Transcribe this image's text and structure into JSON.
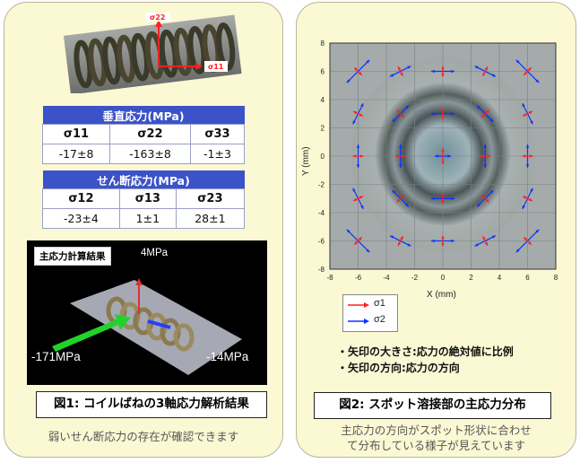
{
  "left": {
    "photo": {
      "s22_label": "σ22",
      "s11_label": "σ11"
    },
    "normal_table": {
      "title": "垂直応力(MPa)",
      "headers": [
        "σ11",
        "σ22",
        "σ33"
      ],
      "values": [
        "-17±8",
        "-163±8",
        "-1±3"
      ]
    },
    "shear_table": {
      "title": "せん断応力(MPa)",
      "headers": [
        "σ12",
        "σ13",
        "σ23"
      ],
      "values": [
        "-23±4",
        "1±1",
        "28±1"
      ]
    },
    "box3d": {
      "label": "主応力計算結果",
      "top_value": "4MPa",
      "left_value": "-171MPa",
      "right_value": "-14MPa"
    },
    "caption": "図1: コイルばねの3軸応力解析結果",
    "note": "弱いせん断応力の存在が確認できます"
  },
  "right": {
    "chart_data": {
      "type": "scatter",
      "xlabel": "X (mm)",
      "ylabel": "Y (mm)",
      "xlim": [
        -8,
        8
      ],
      "ylim": [
        -8,
        8
      ],
      "xticks": [
        -8,
        -6,
        -4,
        -2,
        0,
        2,
        4,
        6,
        8
      ],
      "yticks": [
        -8,
        -6,
        -4,
        -2,
        0,
        2,
        4,
        6,
        8
      ],
      "grid": true,
      "legend_position": "bottom-left",
      "series": [
        {
          "name": "σ1",
          "color": "#ff2020"
        },
        {
          "name": "σ2",
          "color": "#1030ff"
        }
      ],
      "points": [
        {
          "x": -6,
          "y": 6
        },
        {
          "x": -3,
          "y": 6
        },
        {
          "x": 0,
          "y": 6
        },
        {
          "x": 3,
          "y": 6
        },
        {
          "x": 6,
          "y": 6
        },
        {
          "x": -6,
          "y": 3
        },
        {
          "x": -3,
          "y": 3
        },
        {
          "x": 0,
          "y": 3
        },
        {
          "x": 3,
          "y": 3
        },
        {
          "x": 6,
          "y": 3
        },
        {
          "x": -6,
          "y": 0
        },
        {
          "x": -3,
          "y": 0
        },
        {
          "x": 0,
          "y": 0
        },
        {
          "x": 3,
          "y": 0
        },
        {
          "x": 6,
          "y": 0
        },
        {
          "x": -6,
          "y": -3
        },
        {
          "x": -3,
          "y": -3
        },
        {
          "x": 0,
          "y": -3
        },
        {
          "x": 3,
          "y": -3
        },
        {
          "x": 6,
          "y": -3
        },
        {
          "x": -6,
          "y": -6
        },
        {
          "x": -3,
          "y": -6
        },
        {
          "x": 0,
          "y": -6
        },
        {
          "x": 3,
          "y": -6
        },
        {
          "x": 6,
          "y": -6
        }
      ]
    },
    "bullets": [
      "・矢印の大きさ:応力の絶対値に比例",
      "・矢印の方向:応力の方向"
    ],
    "caption": "図2: スポット溶接部の主応力分布",
    "note_line1": "主応力の方向がスポット形状に合わせ",
    "note_line2": "て分布している様子が見えています"
  }
}
